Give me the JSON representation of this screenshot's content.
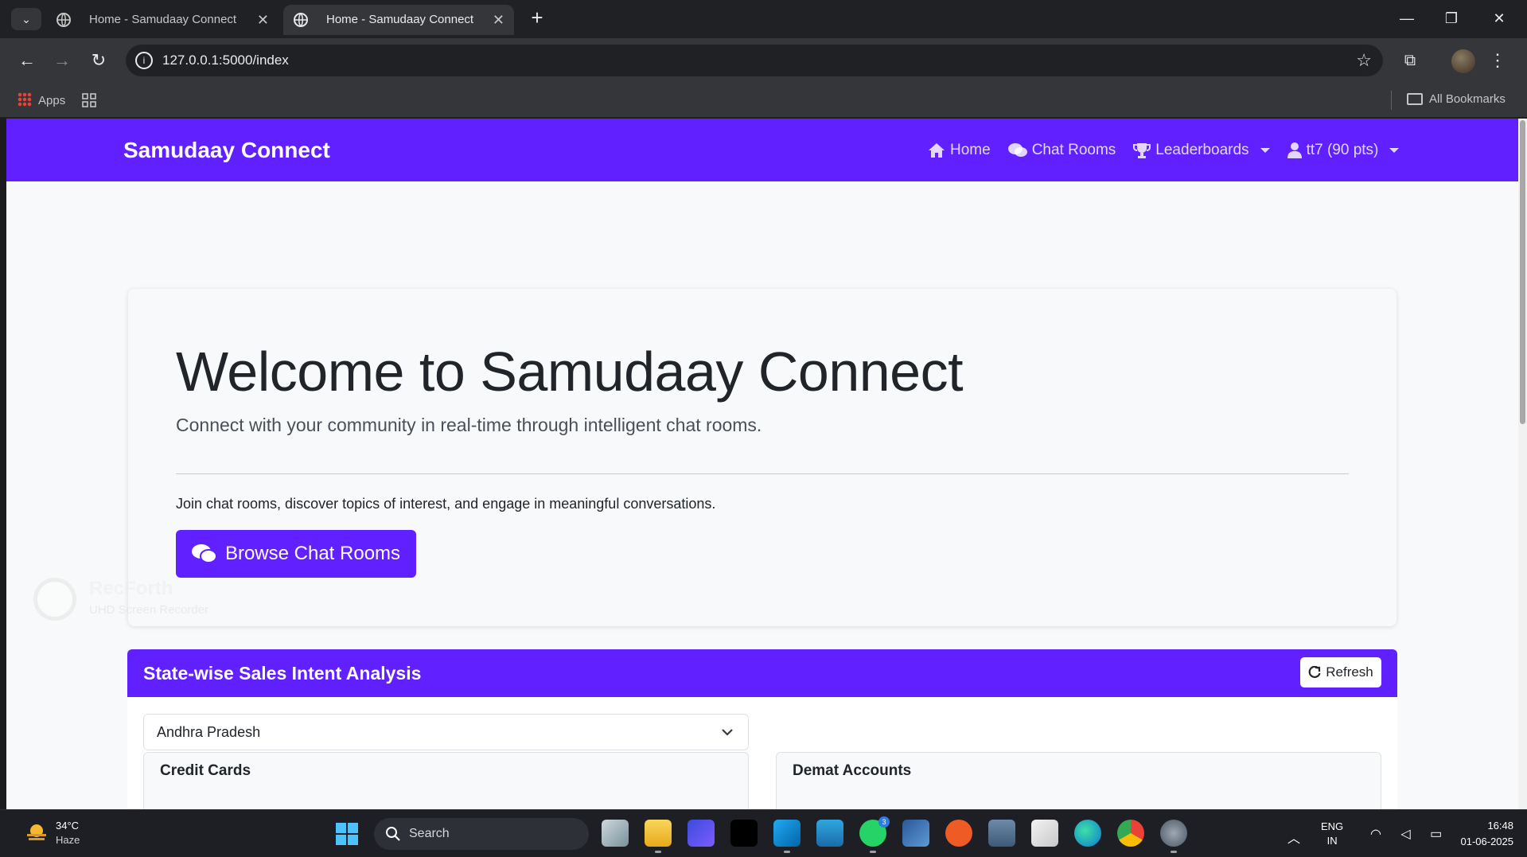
{
  "browser": {
    "tabs": [
      {
        "title": "Home - Samudaay Connect",
        "active": false
      },
      {
        "title": "Home - Samudaay Connect",
        "active": true
      }
    ],
    "url": "127.0.0.1:5000/index",
    "bookmarks": {
      "apps_label": "Apps",
      "all_bookmarks_label": "All Bookmarks"
    }
  },
  "app": {
    "brand": "Samudaay Connect",
    "nav": {
      "home": "Home",
      "chat_rooms": "Chat Rooms",
      "leaderboards": "Leaderboards",
      "user": "tt7 (90 pts)"
    },
    "hero": {
      "title": "Welcome to Samudaay Connect",
      "lead": "Connect with your community in real-time through intelligent chat rooms.",
      "description": "Join chat rooms, discover topics of interest, and engage in meaningful conversations.",
      "button": "Browse Chat Rooms"
    },
    "sales": {
      "title": "State-wise Sales Intent Analysis",
      "refresh": "Refresh",
      "selected_state": "Andhra Pradesh",
      "cards": [
        "Credit Cards",
        "Demat Accounts"
      ]
    },
    "colors": {
      "primary": "#6020ff"
    }
  },
  "watermark": {
    "brand": "RecForth",
    "subtitle": "UHD Screen Recorder"
  },
  "taskbar": {
    "weather": {
      "temp": "34°C",
      "condition": "Haze"
    },
    "search_label": "Search",
    "whatsapp_badge": "3",
    "lang": {
      "line1": "ENG",
      "line2": "IN"
    },
    "clock": {
      "time": "16:48",
      "date": "01-06-2025"
    }
  }
}
